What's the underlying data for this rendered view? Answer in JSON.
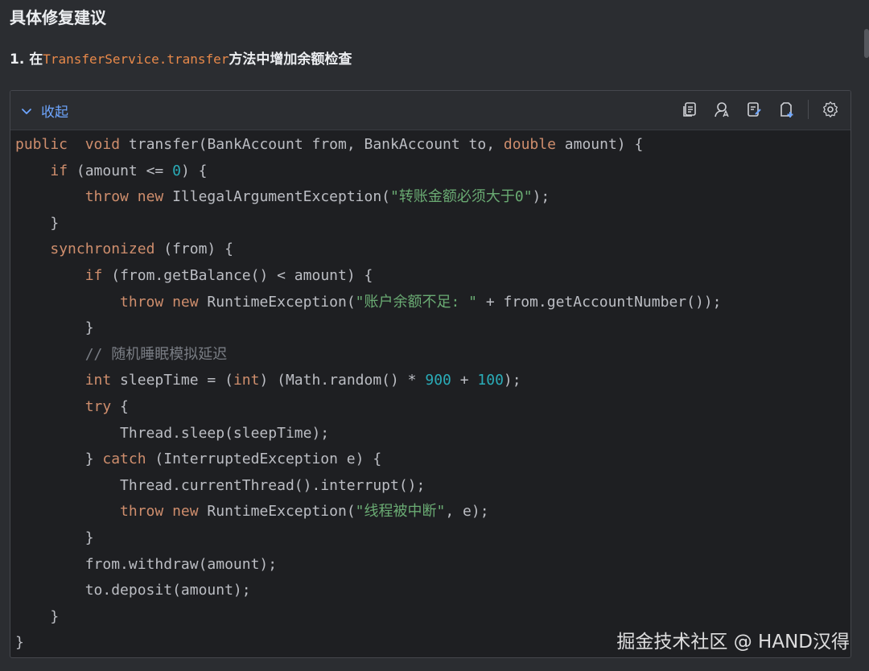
{
  "heading": "具体修复建议",
  "step": {
    "prefix": "1. 在",
    "code_ref": "TransferService.transfer",
    "suffix": "方法中增加余额检查"
  },
  "codebox": {
    "collapse_label": "收起",
    "tool_icons": [
      "copy-icon",
      "ai-assist-icon",
      "apply-icon",
      "insert-icon",
      "settings-icon"
    ]
  },
  "code_lines": [
    [
      [
        "kw",
        "public"
      ],
      [
        "",
        "  "
      ],
      [
        "kw",
        "void"
      ],
      [
        "",
        " transfer(BankAccount from, BankAccount to, "
      ],
      [
        "kw",
        "double"
      ],
      [
        "",
        " amount) {"
      ]
    ],
    [
      [
        "",
        "    "
      ],
      [
        "kw",
        "if"
      ],
      [
        "",
        " (amount <= "
      ],
      [
        "num",
        "0"
      ],
      [
        "",
        ") {"
      ]
    ],
    [
      [
        "",
        "        "
      ],
      [
        "kw",
        "throw"
      ],
      [
        "",
        " "
      ],
      [
        "kw",
        "new"
      ],
      [
        "",
        " IllegalArgumentException("
      ],
      [
        "str",
        "\"转账金额必须大于0\""
      ],
      [
        "",
        ");"
      ]
    ],
    [
      [
        "",
        "    }"
      ]
    ],
    [
      [
        "",
        "    "
      ],
      [
        "kw",
        "synchronized"
      ],
      [
        "",
        " (from) {"
      ]
    ],
    [
      [
        "",
        "        "
      ],
      [
        "kw",
        "if"
      ],
      [
        "",
        " (from.getBalance() < amount) {"
      ]
    ],
    [
      [
        "",
        "            "
      ],
      [
        "kw",
        "throw"
      ],
      [
        "",
        " "
      ],
      [
        "kw",
        "new"
      ],
      [
        "",
        " RuntimeException("
      ],
      [
        "str",
        "\"账户余额不足: \""
      ],
      [
        "",
        " + from.getAccountNumber());"
      ]
    ],
    [
      [
        "",
        "        }"
      ]
    ],
    [
      [
        "",
        "        "
      ],
      [
        "cmt",
        "// 随机睡眠模拟延迟"
      ]
    ],
    [
      [
        "",
        "        "
      ],
      [
        "kw",
        "int"
      ],
      [
        "",
        " sleepTime = ("
      ],
      [
        "kw",
        "int"
      ],
      [
        "",
        ") (Math.random() * "
      ],
      [
        "num",
        "900"
      ],
      [
        "",
        " + "
      ],
      [
        "num",
        "100"
      ],
      [
        "",
        ");"
      ]
    ],
    [
      [
        "",
        "        "
      ],
      [
        "kw",
        "try"
      ],
      [
        "",
        " {"
      ]
    ],
    [
      [
        "",
        "            Thread.sleep(sleepTime);"
      ]
    ],
    [
      [
        "",
        "        } "
      ],
      [
        "kw",
        "catch"
      ],
      [
        "",
        " (InterruptedException e) {"
      ]
    ],
    [
      [
        "",
        "            Thread.currentThread().interrupt();"
      ]
    ],
    [
      [
        "",
        "            "
      ],
      [
        "kw",
        "throw"
      ],
      [
        "",
        " "
      ],
      [
        "kw",
        "new"
      ],
      [
        "",
        " RuntimeException("
      ],
      [
        "str",
        "\"线程被中断\""
      ],
      [
        "",
        ", e);"
      ]
    ],
    [
      [
        "",
        "        }"
      ]
    ],
    [
      [
        "",
        "        from.withdraw(amount);"
      ]
    ],
    [
      [
        "",
        "        to.deposit(amount);"
      ]
    ],
    [
      [
        "",
        "    }"
      ]
    ],
    [
      [
        "",
        "}"
      ]
    ]
  ],
  "watermark": "掘金技术社区 @ HAND汉得",
  "colors": {
    "keyword": "#cf8e6d",
    "number": "#2aacb8",
    "string": "#6aab73",
    "comment": "#7a7e85",
    "link": "#6ea6ff",
    "code_ref": "#e8894a"
  }
}
